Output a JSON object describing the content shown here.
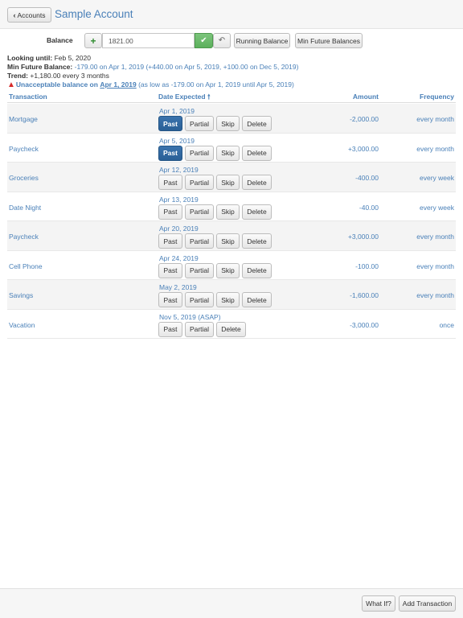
{
  "header": {
    "back_label": "Accounts",
    "title": "Sample Account"
  },
  "balance_bar": {
    "label": "Balance",
    "value": "1821.00",
    "running_balance_label": "Running Balance",
    "min_future_balances_label": "Min Future Balances"
  },
  "info": {
    "looking_until_label": "Looking until:",
    "looking_until_value": "Feb 5, 2020",
    "min_future_label": "Min Future Balance:",
    "min_future_value": "-179.00 on Apr 1, 2019 (+440.00 on Apr 5, 2019, +100.00 on Dec 5, 2019)",
    "trend_label": "Trend:",
    "trend_value": "+1,180.00 every 3 months",
    "warning_prefix": "Unacceptable balance on",
    "warning_date": "Apr 1, 2019",
    "warning_detail": "(as low as -179.00 on Apr 1, 2019 until Apr 5, 2019)"
  },
  "table": {
    "headers": {
      "transaction": "Transaction",
      "date_expected": "Date Expected",
      "amount": "Amount",
      "frequency": "Frequency"
    },
    "button_labels": {
      "past": "Past",
      "partial": "Partial",
      "skip": "Skip",
      "delete": "Delete"
    },
    "rows": [
      {
        "name": "Mortgage",
        "date": "Apr 1, 2019",
        "amount": "-2,000.00",
        "frequency": "every month"
      },
      {
        "name": "Paycheck",
        "date": "Apr 5, 2019",
        "amount": "+3,000.00",
        "frequency": "every month"
      },
      {
        "name": "Groceries",
        "date": "Apr 12, 2019",
        "amount": "-400.00",
        "frequency": "every week"
      },
      {
        "name": "Date Night",
        "date": "Apr 13, 2019",
        "amount": "-40.00",
        "frequency": "every week"
      },
      {
        "name": "Paycheck",
        "date": "Apr 20, 2019",
        "amount": "+3,000.00",
        "frequency": "every month"
      },
      {
        "name": "Cell Phone",
        "date": "Apr 24, 2019",
        "amount": "-100.00",
        "frequency": "every month"
      },
      {
        "name": "Savings",
        "date": "May 2, 2019",
        "amount": "-1,600.00",
        "frequency": "every month"
      },
      {
        "name": "Vacation",
        "date": "Nov 5, 2019 (ASAP)",
        "amount": "-3,000.00",
        "frequency": "once"
      }
    ]
  },
  "footer": {
    "what_if_label": "What If?",
    "add_transaction_label": "Add Transaction"
  },
  "colors": {
    "link_blue": "#4a80b8",
    "active_button": "#2a5f96",
    "confirm_green": "#5cb05c",
    "warning_red": "#d62b2b"
  },
  "icons": [
    "chevron-left-icon",
    "plus-icon",
    "check-icon",
    "undo-icon",
    "sort-arrow-up-icon",
    "warning-icon"
  ]
}
